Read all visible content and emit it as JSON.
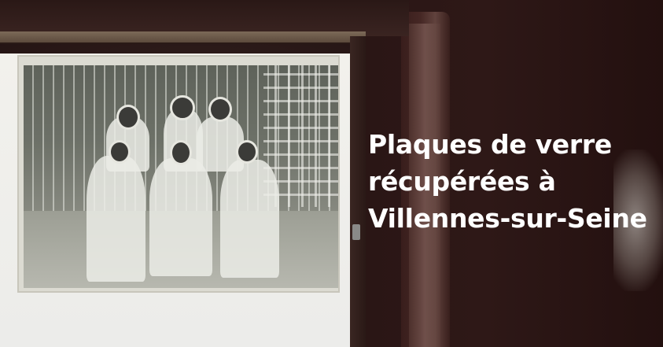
{
  "photo": {
    "subject": "glass-plate-negative-on-lightbox"
  },
  "caption": {
    "line1": "Plaques de verre",
    "line2": "récupérées à",
    "line3": "Villennes-sur-Seine"
  }
}
